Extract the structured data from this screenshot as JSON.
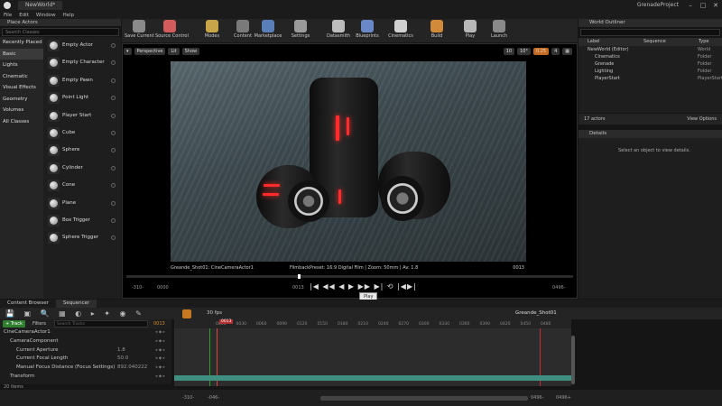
{
  "window": {
    "doc_tab": "NewWorld*",
    "project": "GrenadeProject",
    "controls": [
      "–",
      "□",
      "✕"
    ]
  },
  "menu": [
    "File",
    "Edit",
    "Window",
    "Help"
  ],
  "place_actors": {
    "title": "Place Actors",
    "search_placeholder": "Search Classes",
    "categories": [
      "Recently Placed",
      "Basic",
      "Lights",
      "Cinematic",
      "Visual Effects",
      "Geometry",
      "Volumes",
      "All Classes"
    ],
    "active_category": "Basic",
    "items": [
      "Empty Actor",
      "Empty Character",
      "Empty Pawn",
      "Point Light",
      "Player Start",
      "Cube",
      "Sphere",
      "Cylinder",
      "Cone",
      "Plane",
      "Box Trigger",
      "Sphere Trigger"
    ]
  },
  "toolbar": [
    {
      "label": "Save Current",
      "icon": "save-icon",
      "color": "#8a8a8a"
    },
    {
      "label": "Source Control",
      "icon": "source-control-icon",
      "color": "#d35b5b"
    },
    {
      "label": "Modes",
      "icon": "modes-icon",
      "color": "#c9a54a"
    },
    {
      "label": "Content",
      "icon": "content-icon",
      "color": "#7a7a7a"
    },
    {
      "label": "Marketplace",
      "icon": "marketplace-icon",
      "color": "#5a7fb8"
    },
    {
      "label": "Settings",
      "icon": "settings-icon",
      "color": "#9a9a9a"
    },
    {
      "label": "Datasmith",
      "icon": "datasmith-icon",
      "color": "#bcbcbc"
    },
    {
      "label": "Blueprints",
      "icon": "blueprints-icon",
      "color": "#6a88c8"
    },
    {
      "label": "Cinematics",
      "icon": "cinematics-icon",
      "color": "#d0d0d0"
    },
    {
      "label": "Build",
      "icon": "build-icon",
      "color": "#d08a3a"
    },
    {
      "label": "Play",
      "icon": "play-icon",
      "color": "#b8b8b8"
    },
    {
      "label": "Launch",
      "icon": "launch-icon",
      "color": "#8a8a8a"
    }
  ],
  "viewport": {
    "perspective": "Perspective",
    "lit": "Lit",
    "show": "Show",
    "snap_values": [
      "10",
      "10°",
      "0.25",
      "4"
    ],
    "info_left": "Greande_Shot01: CineCameraActor1",
    "info_center": "FilmbackPreset: 16:9 Digital Film | Zoom: 50mm | Av: 1.8",
    "info_right": "0013",
    "transport_left_a": "-310-",
    "transport_left_b": "0000",
    "transport_right_a": "0013",
    "transport_right_b": "0496-",
    "tooltip": "Play"
  },
  "outliner": {
    "title": "World Outliner",
    "cols": {
      "label": "Label",
      "sequence": "Sequence",
      "type": "Type"
    },
    "rows": [
      {
        "label": "NewWorld (Editor)",
        "type": "World"
      },
      {
        "label": "Cinematics",
        "type": "Folder"
      },
      {
        "label": "Grenade",
        "type": "Folder"
      },
      {
        "label": "Lighting",
        "type": "Folder"
      },
      {
        "label": "PlayerStart",
        "type": "PlayerStart"
      }
    ],
    "count": "17 actors",
    "view_options": "View Options"
  },
  "details": {
    "title": "Details",
    "empty_text": "Select an object to view details."
  },
  "sequencer": {
    "tabs": [
      "Content Browser",
      "Sequencer"
    ],
    "active_tab": "Sequencer",
    "fps": "30 fps",
    "frame": "0013",
    "sequence_name": "Greande_Shot01",
    "add_track": "+ Track",
    "filters": "Filters",
    "search_placeholder": "Search Tracks",
    "current_frame": "0013",
    "tracks": [
      {
        "name": "CineCameraActor1",
        "value": "",
        "indent": 0
      },
      {
        "name": "CameraComponent",
        "value": "",
        "indent": 1
      },
      {
        "name": "Current Aperture",
        "value": "1.8",
        "indent": 2
      },
      {
        "name": "Current Focal Length",
        "value": "50.0",
        "indent": 2
      },
      {
        "name": "Manual Focus Distance (Focus Settings)",
        "value": "892.040222",
        "indent": 2
      },
      {
        "name": "Transform",
        "value": "",
        "indent": 1
      }
    ],
    "items_count": "20 items",
    "ruler_ticks": [
      "0000",
      "0030",
      "0060",
      "0090",
      "0120",
      "0150",
      "0180",
      "0210",
      "0240",
      "0270",
      "0300",
      "0330",
      "0360",
      "0390",
      "0420",
      "0450",
      "0480"
    ],
    "bottom_left_a": "-310-",
    "bottom_left_b": "-046-",
    "bottom_right_a": "0496-",
    "bottom_right_b": "0496+"
  }
}
